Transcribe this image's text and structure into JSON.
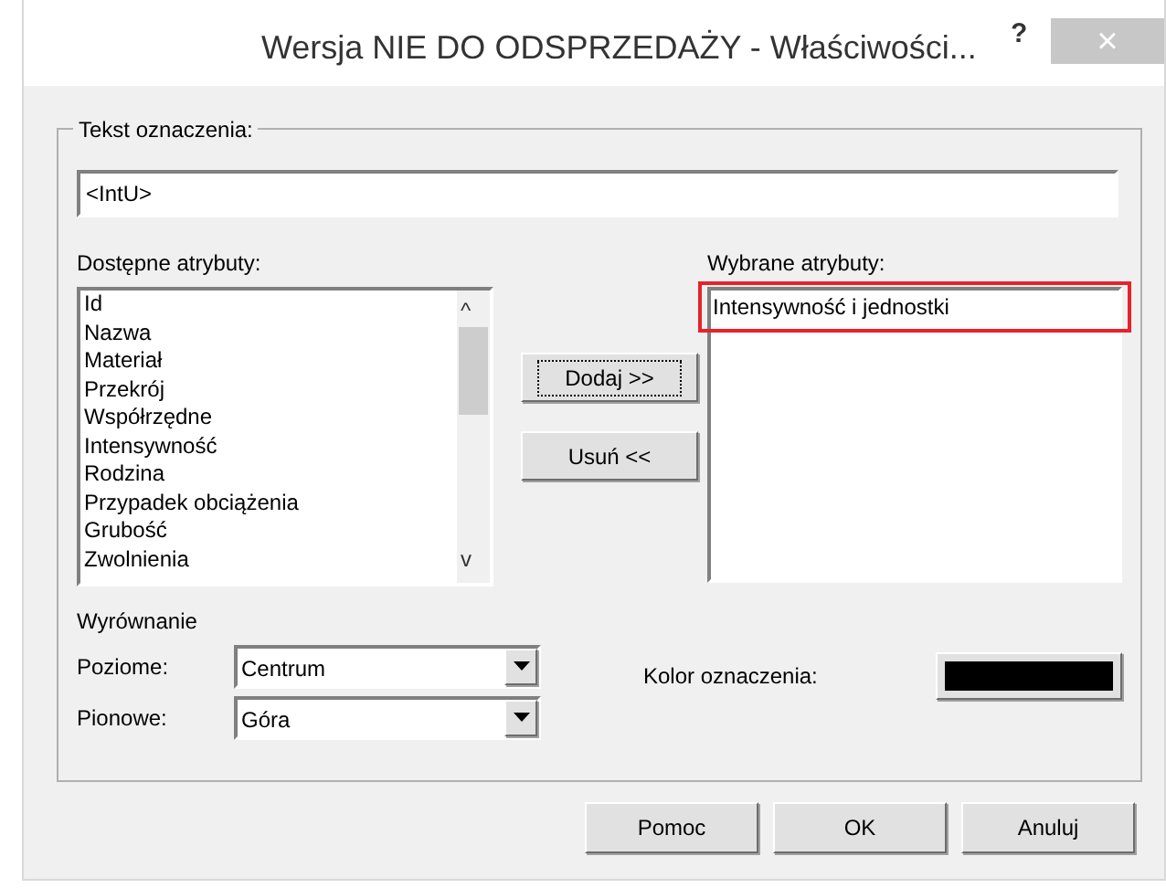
{
  "window": {
    "title": "Wersja NIE DO ODSPRZEDAŻY - Właściwości...",
    "help": "?",
    "close": "×"
  },
  "label_text": {
    "legend": "Tekst oznaczenia:",
    "value": "<IntU>"
  },
  "available": {
    "label": "Dostępne atrybuty:",
    "items": [
      {
        "text": "Id"
      },
      {
        "text": "Nazwa"
      },
      {
        "text": "Materiał"
      },
      {
        "text": "Przekrój"
      },
      {
        "text": "Współrzędne"
      },
      {
        "text": "Intensywność"
      },
      {
        "text": "Rodzina"
      },
      {
        "text": "Przypadek obciążenia"
      },
      {
        "text": "Grubość"
      },
      {
        "text": "Zwolnienia"
      }
    ],
    "scroll_up": "^",
    "scroll_down": "v"
  },
  "move_buttons": [
    {
      "label": "Dodaj >>",
      "focused": true
    },
    {
      "label": "Usuń <<",
      "focused": false
    }
  ],
  "selected": {
    "label": "Wybrane atrybuty:",
    "items": [
      {
        "text": "Intensywność i jednostki",
        "highlighted": true
      }
    ]
  },
  "alignment": {
    "title": "Wyrównanie",
    "rows": [
      {
        "label": "Poziome:",
        "value": "Centrum"
      },
      {
        "label": "Pionowe:",
        "value": "Góra"
      }
    ]
  },
  "color": {
    "label": "Kolor oznaczenia:",
    "color": "#000000"
  },
  "buttons": [
    {
      "label": "Pomoc"
    },
    {
      "label": "OK"
    },
    {
      "label": "Anuluj"
    }
  ]
}
